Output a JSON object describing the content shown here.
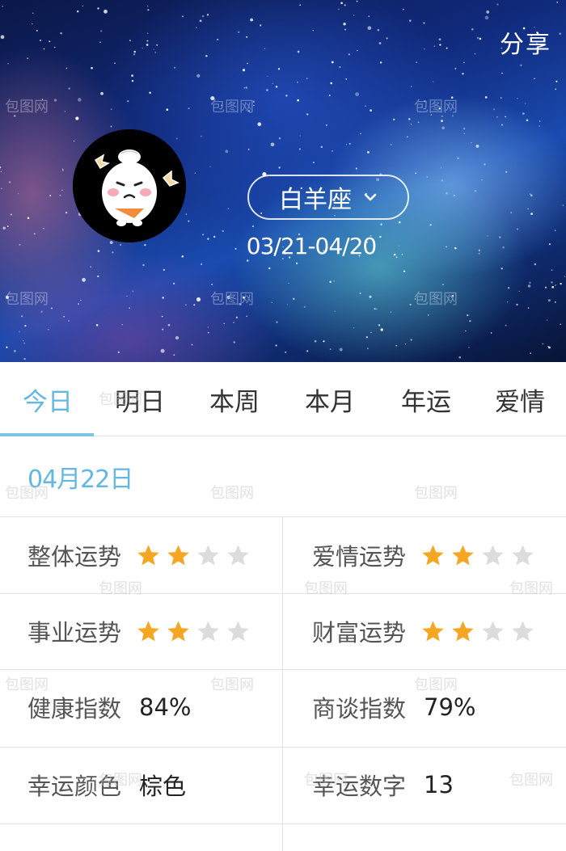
{
  "header": {
    "share_label": "分享",
    "sign_name": "白羊座",
    "date_range": "03/21-04/20"
  },
  "tabs": [
    {
      "label": "今日",
      "active": true
    },
    {
      "label": "明日",
      "active": false
    },
    {
      "label": "本周",
      "active": false
    },
    {
      "label": "本月",
      "active": false
    },
    {
      "label": "年运",
      "active": false
    },
    {
      "label": "爱情",
      "active": false
    }
  ],
  "date_label": "04月22日",
  "fortune": {
    "overall": {
      "label": "整体运势",
      "stars": 2,
      "max_stars": 4
    },
    "love": {
      "label": "爱情运势",
      "stars": 2,
      "max_stars": 4
    },
    "career": {
      "label": "事业运势",
      "stars": 2,
      "max_stars": 4
    },
    "wealth": {
      "label": "财富运势",
      "stars": 2,
      "max_stars": 4
    },
    "health": {
      "label": "健康指数",
      "value": "84%"
    },
    "negotiation": {
      "label": "商谈指数",
      "value": "79%"
    },
    "lucky_color": {
      "label": "幸运颜色",
      "value": "棕色"
    },
    "lucky_number": {
      "label": "幸运数字",
      "value": "13"
    }
  },
  "watermark": "包图网",
  "colors": {
    "accent": "#63b8e0",
    "star_on": "#f5a623",
    "star_off": "#dcdcdc"
  }
}
